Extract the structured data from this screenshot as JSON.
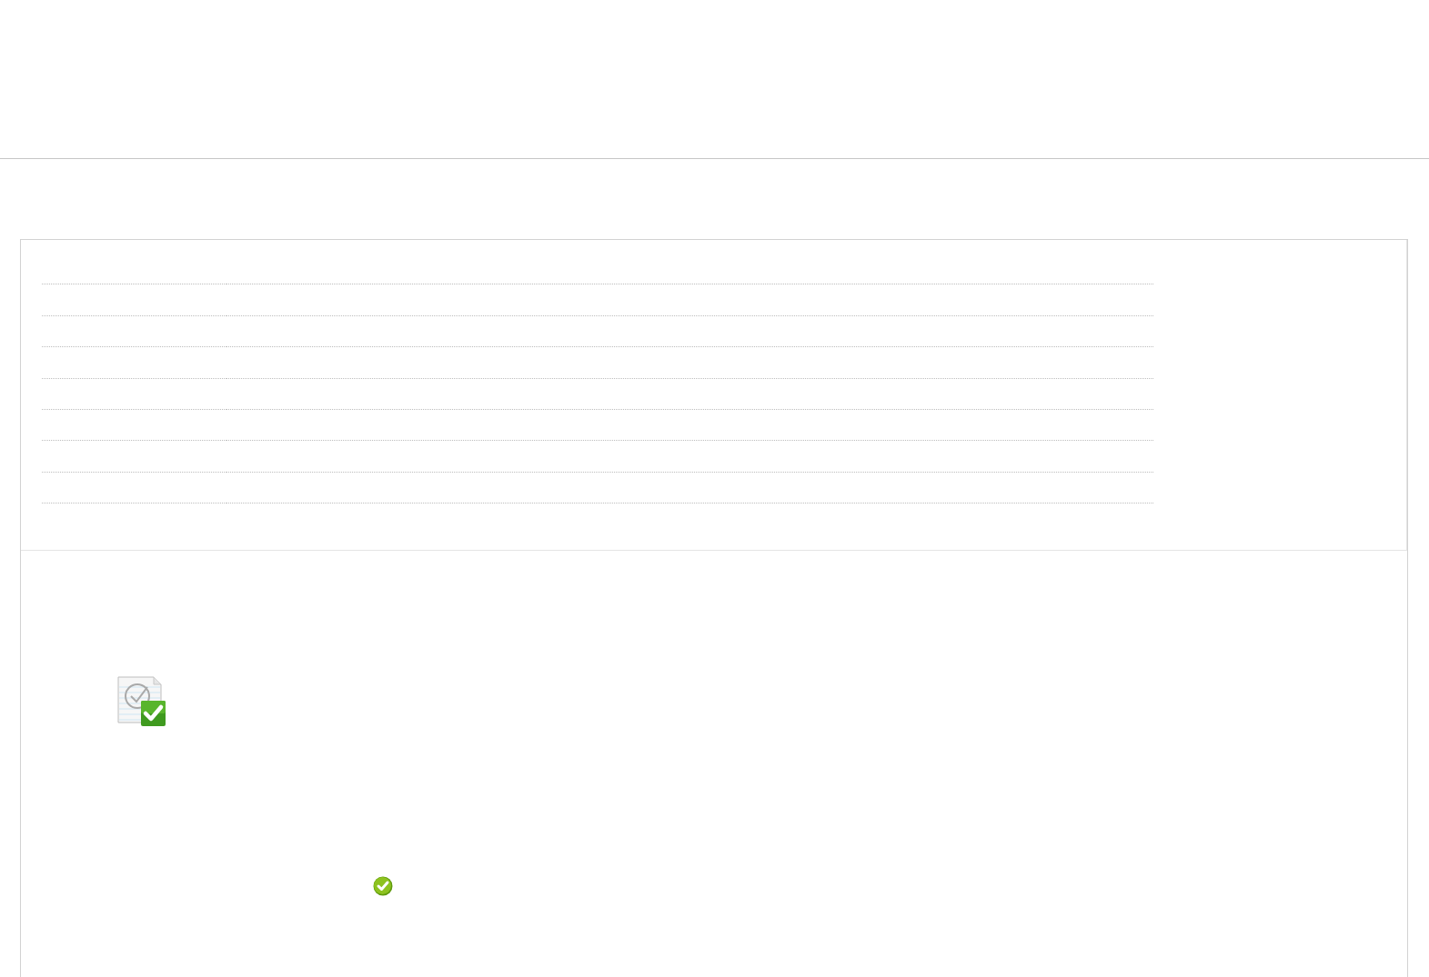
{
  "table": {
    "rows": [
      {
        "kind": "blank"
      },
      {
        "kind": "blank"
      },
      {
        "kind": "blank"
      },
      {
        "kind": "blank"
      },
      {
        "kind": "blank"
      },
      {
        "kind": "blank"
      },
      {
        "kind": "blank"
      },
      {
        "kind": "blank"
      }
    ]
  },
  "result": {
    "document": {
      "kind": "checked"
    },
    "status": {
      "kind": "success"
    }
  }
}
